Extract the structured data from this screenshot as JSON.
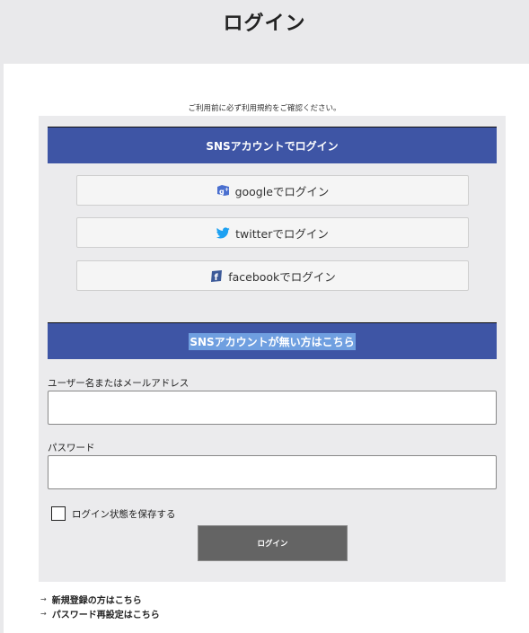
{
  "header": {
    "title": "ログイン"
  },
  "notice": "ご利用前に必ず利用規約をご確認ください。",
  "sns_section": {
    "heading": "SNSアカウントでログイン",
    "buttons": [
      {
        "label": "googleでログイン",
        "icon": "google-plus-icon"
      },
      {
        "label": "twitterでログイン",
        "icon": "twitter-icon"
      },
      {
        "label": "facebookでログイン",
        "icon": "facebook-icon"
      }
    ]
  },
  "account_section": {
    "heading": "SNSアカウントが無い方はこちら",
    "username_label": "ユーザー名またはメールアドレス",
    "username_value": "",
    "password_label": "パスワード",
    "password_value": "",
    "remember_label": "ログイン状態を保存する",
    "remember_checked": false,
    "login_button": "ログイン"
  },
  "links": [
    {
      "arrow": "→",
      "label": "新規登録の方はこちら"
    },
    {
      "arrow": "→",
      "label": "パスワード再設定はこちら"
    }
  ],
  "colors": {
    "bar": "#3e55a5",
    "panel": "#ebebed",
    "login_button": "#646464",
    "twitter": "#1da1f2",
    "facebook": "#3b5998",
    "google": "#4a6fcf"
  }
}
